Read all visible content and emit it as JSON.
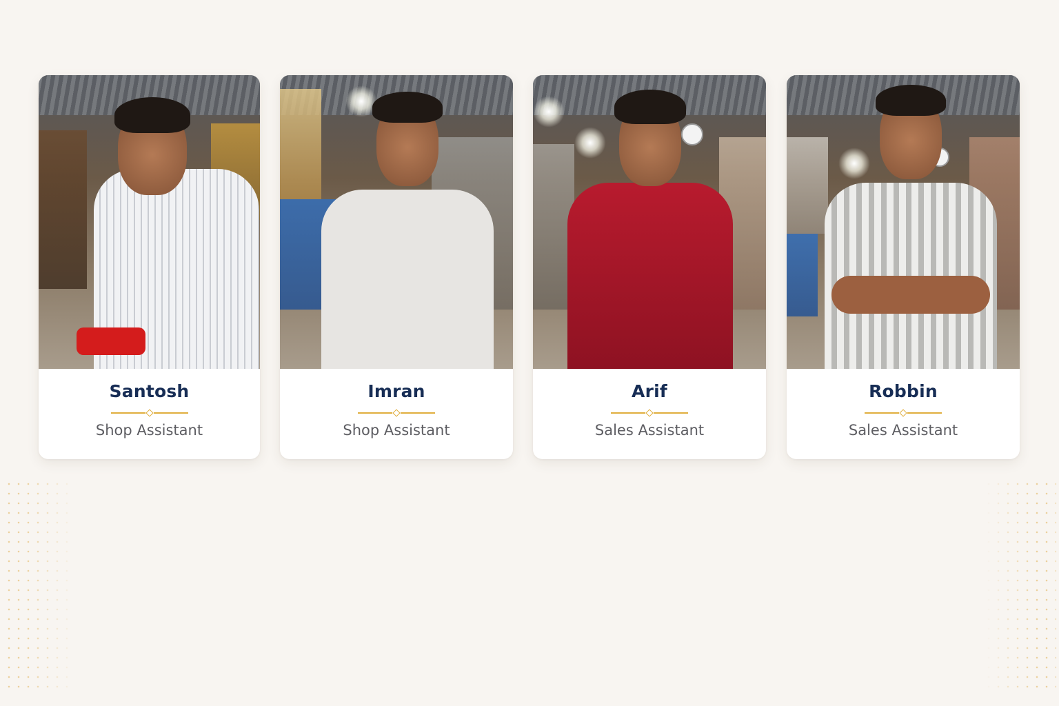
{
  "colors": {
    "background": "#f8f5f1",
    "card": "#ffffff",
    "name_text": "#172d55",
    "role_text": "#5d5d62",
    "accent_gold": "#e0ae3e"
  },
  "team": [
    {
      "name": "Santosh",
      "role": "Shop Assistant",
      "shirt_color": "#eef0f2"
    },
    {
      "name": "Imran",
      "role": "Shop Assistant",
      "shirt_color": "#e6e4e1"
    },
    {
      "name": "Arif",
      "role": "Sales Assistant",
      "shirt_color": "#b0182a"
    },
    {
      "name": "Robbin",
      "role": "Sales Assistant",
      "shirt_color": "#d6d6d4"
    }
  ]
}
